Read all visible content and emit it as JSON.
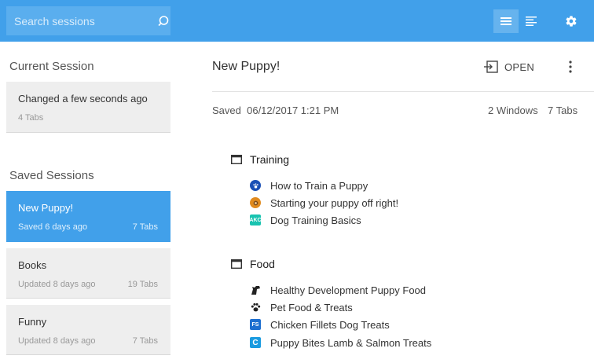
{
  "search": {
    "placeholder": "Search sessions"
  },
  "toolbar": {
    "list_view": "list-view",
    "detail_view": "detail-view",
    "settings": "settings"
  },
  "sidebar": {
    "current_title": "Current Session",
    "current": {
      "title": "Changed a few seconds ago",
      "subtitle": "4 Tabs"
    },
    "saved_title": "Saved Sessions",
    "sessions": [
      {
        "title": "New Puppy!",
        "subtitle": "Saved 6 days ago",
        "tabs": "7 Tabs",
        "selected": true
      },
      {
        "title": "Books",
        "subtitle": "Updated 8 days ago",
        "tabs": "19 Tabs",
        "selected": false
      },
      {
        "title": "Funny",
        "subtitle": "Updated 8 days ago",
        "tabs": "7 Tabs",
        "selected": false
      }
    ]
  },
  "detail": {
    "title": "New Puppy!",
    "open_label": "OPEN",
    "saved_label": "Saved",
    "saved_date": "06/12/2017 1:21 PM",
    "windows_count": "2 Windows",
    "tabs_count": "7 Tabs",
    "windows": [
      {
        "name": "Training",
        "tabs": [
          {
            "title": "How to Train a Puppy",
            "icon": "paw-blue-icon",
            "color": "#1a4fb5"
          },
          {
            "title": "Starting your puppy off right!",
            "icon": "dog-badge-icon",
            "color": "#e08a1e"
          },
          {
            "title": "Dog Training Basics",
            "icon": "akc-icon",
            "color": "#19c3b0",
            "badge": "AKC"
          }
        ]
      },
      {
        "name": "Food",
        "tabs": [
          {
            "title": "Healthy Development Puppy Food",
            "icon": "dog-silhouette-icon",
            "color": "#222222"
          },
          {
            "title": "Pet Food & Treats",
            "icon": "paw-print-icon",
            "color": "#222222"
          },
          {
            "title": "Chicken Fillets Dog Treats",
            "icon": "fs-icon",
            "color": "#1e6fd0",
            "badge": "FS"
          },
          {
            "title": "Puppy Bites Lamb & Salmon Treats",
            "icon": "c-logo-icon",
            "color": "#1a9be0",
            "badge": "C"
          }
        ]
      }
    ]
  }
}
